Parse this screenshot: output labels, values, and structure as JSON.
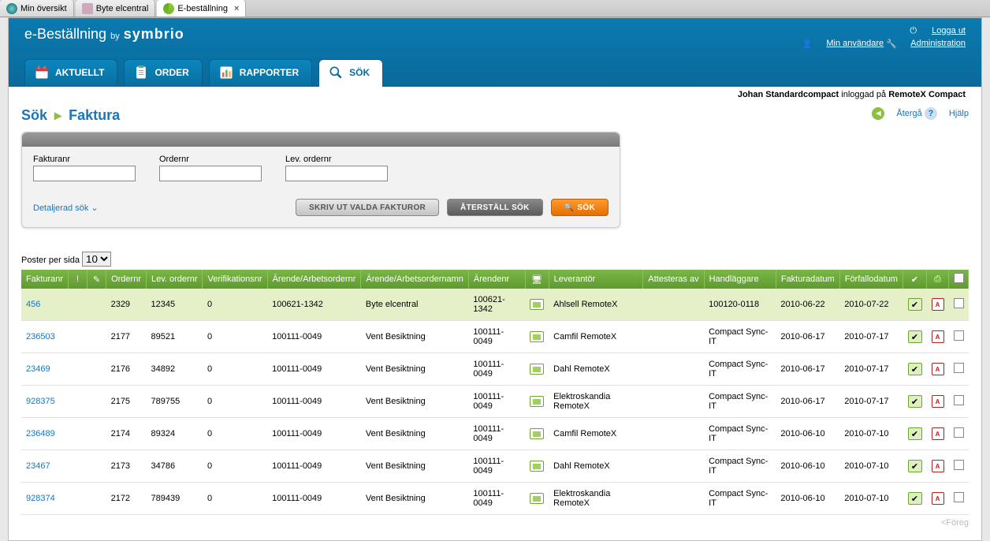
{
  "browser_tabs": [
    {
      "label": "Min översikt",
      "active": false
    },
    {
      "label": "Byte elcentral",
      "active": false
    },
    {
      "label": "E-beställning",
      "active": true
    }
  ],
  "brand": {
    "app": "e-Beställning",
    "by": "by",
    "vendor": "symbrio"
  },
  "toplinks": {
    "logout": "Logga ut",
    "myuser": "Min användare",
    "admin": "Administration"
  },
  "tabs": [
    {
      "label": "AKTUELLT"
    },
    {
      "label": "ORDER"
    },
    {
      "label": "RAPPORTER"
    },
    {
      "label": "SÖK",
      "active": true
    }
  ],
  "userbar": {
    "name": "Johan Standardcompact",
    "middle": " inloggad på ",
    "system": "RemoteX Compact"
  },
  "crumb": {
    "root": "Sök",
    "current": "Faktura"
  },
  "rightlinks": {
    "back": "Återgå",
    "help": "Hjälp"
  },
  "search": {
    "fakturanr_label": "Fakturanr",
    "ordernr_label": "Ordernr",
    "levordernr_label": "Lev. ordernr",
    "fakturanr": "",
    "ordernr": "",
    "levordernr": "",
    "detailed": "Detaljerad sök",
    "print_btn": "SKRIV UT VALDA FAKTUROR",
    "reset_btn": "ÅTERSTÄLL SÖK",
    "search_btn": "SÖK"
  },
  "perpage": {
    "label": "Poster per sida",
    "value": "10"
  },
  "columns": [
    "Fakturanr",
    "",
    "",
    "Ordernr",
    "Lev. ordernr",
    "Verifikationsnr",
    "Ärende/Arbetsordernr",
    "Ärende/Arbetsordernamn",
    "Ärendenr",
    "",
    "Leverantör",
    "Attesteras av",
    "Handläggare",
    "Fakturadatum",
    "Förfallodatum"
  ],
  "rows": [
    {
      "fakturanr": "456",
      "ordernr": "2329",
      "levordernr": "12345",
      "verif": "0",
      "arendenr_full": "100621-1342",
      "arendenamn": "Byte elcentral",
      "arendenr": "100621-1342",
      "lev": "Ahlsell RemoteX",
      "attest": "",
      "handl": "100120-0118",
      "fdatum": "2010-06-22",
      "fforfallo": "2010-07-22",
      "sel": true
    },
    {
      "fakturanr": "236503",
      "ordernr": "2177",
      "levordernr": "89521",
      "verif": "0",
      "arendenr_full": "100111-0049",
      "arendenamn": "Vent Besiktning",
      "arendenr": "100111-0049",
      "lev": "Camfil RemoteX",
      "attest": "",
      "handl": "Compact Sync-IT",
      "fdatum": "2010-06-17",
      "fforfallo": "2010-07-17"
    },
    {
      "fakturanr": "23469",
      "ordernr": "2176",
      "levordernr": "34892",
      "verif": "0",
      "arendenr_full": "100111-0049",
      "arendenamn": "Vent Besiktning",
      "arendenr": "100111-0049",
      "lev": "Dahl RemoteX",
      "attest": "",
      "handl": "Compact Sync-IT",
      "fdatum": "2010-06-17",
      "fforfallo": "2010-07-17"
    },
    {
      "fakturanr": "928375",
      "ordernr": "2175",
      "levordernr": "789755",
      "verif": "0",
      "arendenr_full": "100111-0049",
      "arendenamn": "Vent Besiktning",
      "arendenr": "100111-0049",
      "lev": "Elektroskandia RemoteX",
      "attest": "",
      "handl": "Compact Sync-IT",
      "fdatum": "2010-06-17",
      "fforfallo": "2010-07-17"
    },
    {
      "fakturanr": "236489",
      "ordernr": "2174",
      "levordernr": "89324",
      "verif": "0",
      "arendenr_full": "100111-0049",
      "arendenamn": "Vent Besiktning",
      "arendenr": "100111-0049",
      "lev": "Camfil RemoteX",
      "attest": "",
      "handl": "Compact Sync-IT",
      "fdatum": "2010-06-10",
      "fforfallo": "2010-07-10"
    },
    {
      "fakturanr": "23467",
      "ordernr": "2173",
      "levordernr": "34786",
      "verif": "0",
      "arendenr_full": "100111-0049",
      "arendenamn": "Vent Besiktning",
      "arendenr": "100111-0049",
      "lev": "Dahl RemoteX",
      "attest": "",
      "handl": "Compact Sync-IT",
      "fdatum": "2010-06-10",
      "fforfallo": "2010-07-10"
    },
    {
      "fakturanr": "928374",
      "ordernr": "2172",
      "levordernr": "789439",
      "verif": "0",
      "arendenr_full": "100111-0049",
      "arendenamn": "Vent Besiktning",
      "arendenr": "100111-0049",
      "lev": "Elektroskandia RemoteX",
      "attest": "",
      "handl": "Compact Sync-IT",
      "fdatum": "2010-06-10",
      "fforfallo": "2010-07-10"
    }
  ],
  "prev": "<Föreg"
}
